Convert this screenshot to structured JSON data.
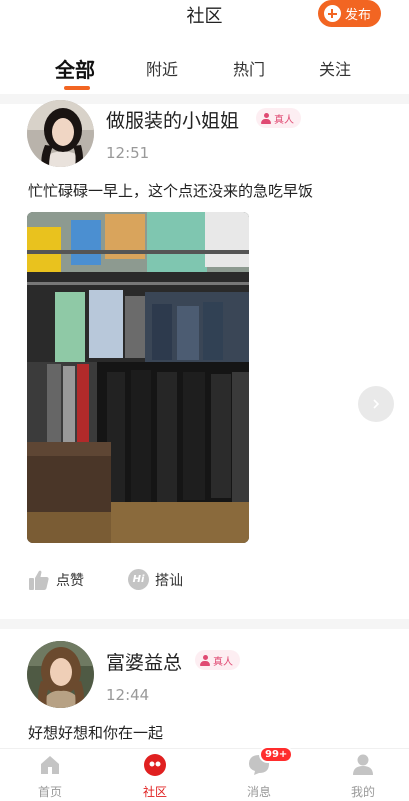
{
  "header": {
    "title": "社区",
    "publish_label": "发布"
  },
  "tabs": [
    {
      "label": "全部",
      "active": true
    },
    {
      "label": "附近",
      "active": false
    },
    {
      "label": "热门",
      "active": false
    },
    {
      "label": "关注",
      "active": false
    }
  ],
  "posts": [
    {
      "username": "做服装的小姐姐",
      "badge": "真人",
      "time": "12:51",
      "text": "忙忙碌碌一早上，这个点还没来的急吃早饭",
      "actions": {
        "like": "点赞",
        "chat": "搭讪"
      },
      "icons": {
        "like": "thumbs-up-icon",
        "chat": "hi-icon"
      }
    },
    {
      "username": "富婆益总",
      "badge": "真人",
      "time": "12:44",
      "text": "好想好想和你在一起"
    }
  ],
  "chat_icon_text": "Hi",
  "bottom_nav": [
    {
      "label": "首页",
      "icon": "home-icon",
      "active": false
    },
    {
      "label": "社区",
      "icon": "community-icon",
      "active": true
    },
    {
      "label": "消息",
      "icon": "message-icon",
      "active": false,
      "badge": "99+"
    },
    {
      "label": "我的",
      "icon": "profile-icon",
      "active": false
    }
  ],
  "colors": {
    "accent": "#f26522",
    "badge_pink": "#e04a73",
    "active_nav": "#e02020",
    "notification": "#ff2d2d"
  }
}
